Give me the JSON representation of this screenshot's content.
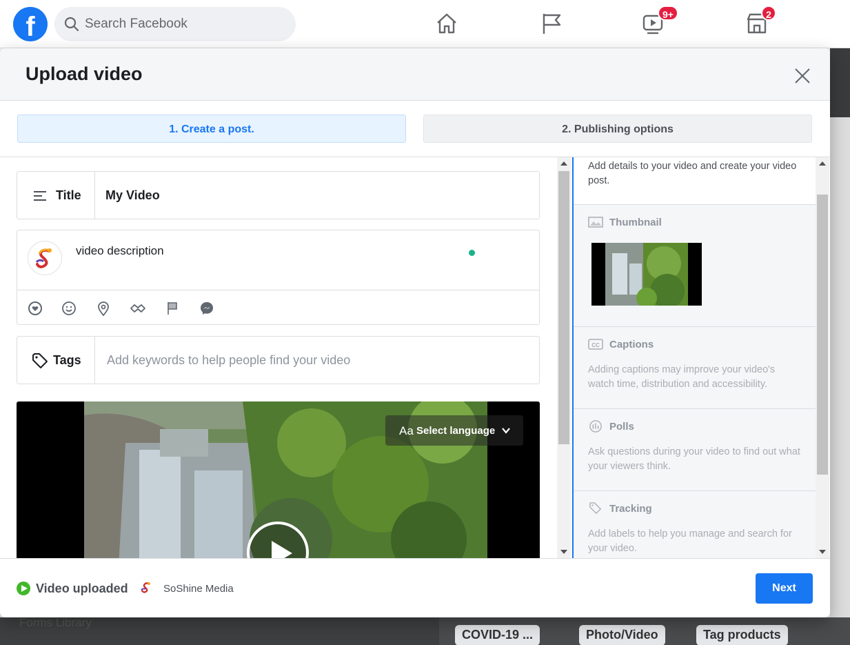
{
  "topbar": {
    "logo_letter": "f",
    "search_placeholder": "Search Facebook",
    "watch_badge": "9+",
    "marketplace_badge": "2"
  },
  "background": {
    "forms_library": "Forms Library",
    "chips": [
      "COVID-19 ...",
      "Photo/Video",
      "Tag products"
    ]
  },
  "modal": {
    "title": "Upload video",
    "steps": [
      "1. Create a post.",
      "2. Publishing options"
    ]
  },
  "form": {
    "title_label": "Title",
    "title_value": "My Video",
    "description_placeholder": "video description",
    "tags_label": "Tags",
    "tags_placeholder": "Add keywords to help people find your video"
  },
  "video": {
    "lang_aa": "Aa",
    "select_language": "Select language"
  },
  "sidebar": {
    "intro": "Add details to your video and create your video post.",
    "sections": [
      {
        "title": "Thumbnail",
        "icon": "image-icon",
        "body": ""
      },
      {
        "title": "Captions",
        "icon": "cc-icon",
        "body": "Adding captions may improve your video's watch time, distribution and accessibility."
      },
      {
        "title": "Polls",
        "icon": "poll-icon",
        "body": "Ask questions during your video to find out what your viewers think."
      },
      {
        "title": "Tracking",
        "icon": "tag-icon",
        "body": "Add labels to help you manage and search for your video."
      }
    ]
  },
  "footer": {
    "status": "Video uploaded",
    "page_name": "SoShine Media",
    "next_label": "Next"
  },
  "colors": {
    "brand": "#1877f2",
    "success": "#42b72a",
    "badge": "#e41e3f"
  }
}
